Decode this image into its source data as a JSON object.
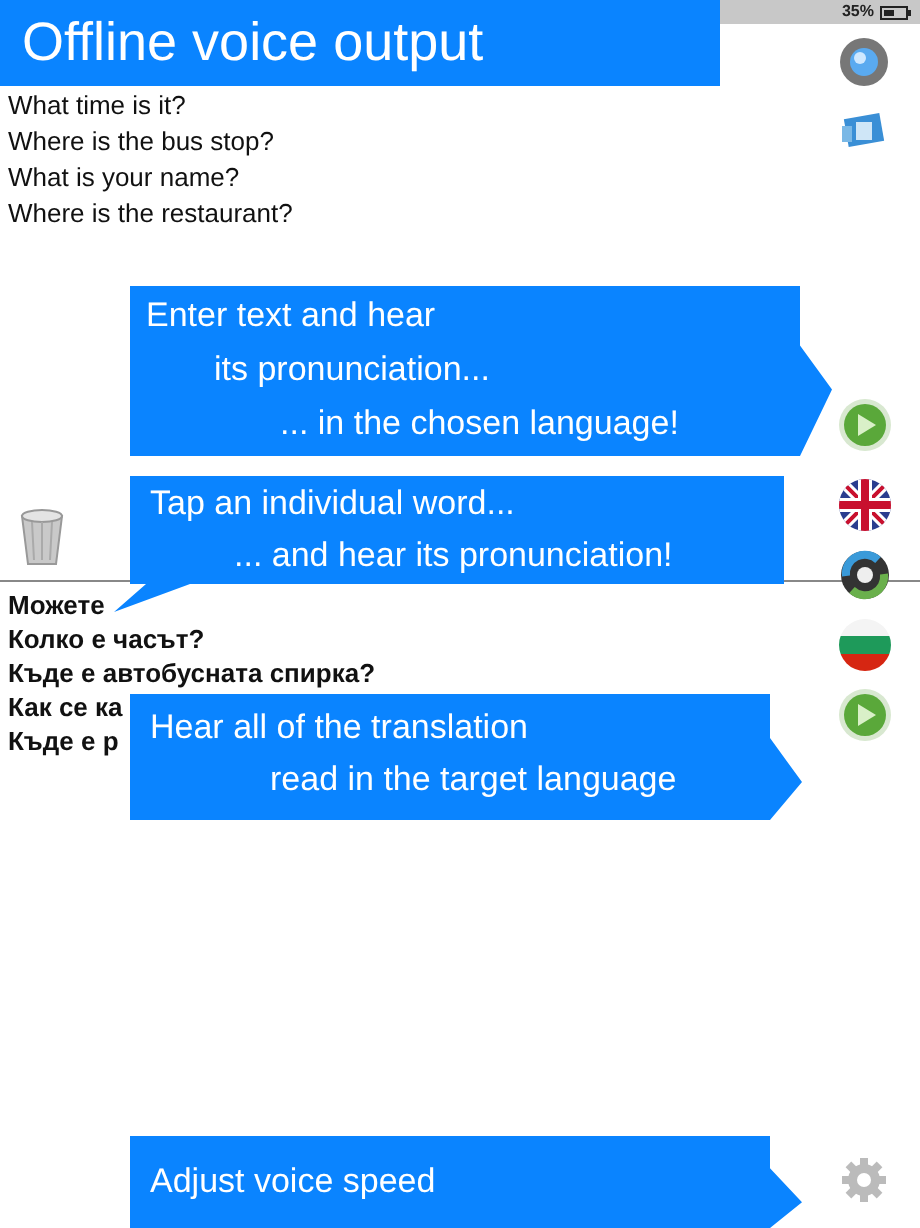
{
  "status_bar": {
    "battery": "35%"
  },
  "title": "Offline voice output",
  "source_phrases": [
    "What time is it?",
    "Where is the bus stop?",
    "What is your name?",
    "Where is the restaurant?"
  ],
  "translated_phrases": [
    "Можете",
    "Колко е часът?",
    "Къде е автобусната спирка?",
    "Как се ка",
    "Къде е р"
  ],
  "callouts": [
    {
      "kind": "right",
      "lines": [
        "Enter text and hear",
        "its pronunciation...",
        "... in the chosen language!"
      ]
    },
    {
      "kind": "down",
      "lines": [
        "Tap an individual word...",
        "... and hear its pronunciation!"
      ]
    },
    {
      "kind": "right",
      "lines": [
        "Hear all of the translation",
        "read in the target language"
      ]
    },
    {
      "kind": "right",
      "lines": [
        "Adjust voice speed"
      ]
    }
  ]
}
